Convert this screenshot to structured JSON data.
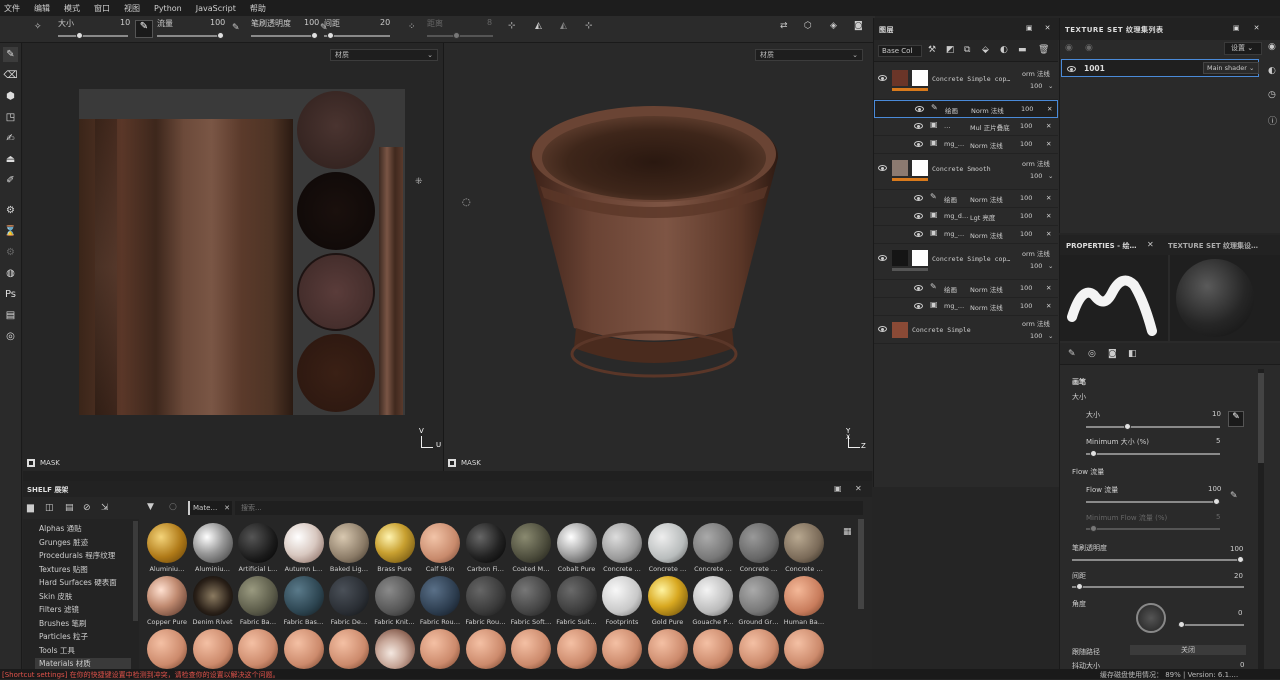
{
  "menu": [
    "文件",
    "编辑",
    "模式",
    "窗口",
    "视图",
    "Python",
    "JavaScript",
    "帮助"
  ],
  "toolbar": {
    "size_label": "大小",
    "size_value": "10",
    "flow_label": "流量",
    "flow_value": "100",
    "opacity_label": "笔刷透明度",
    "opacity_value": "100",
    "spacing_label": "间距",
    "spacing_value": "20",
    "distance_label": "距离",
    "distance_value": "8"
  },
  "viewport2d": {
    "channel": "材质",
    "mask": "MASK",
    "axis_v": "V",
    "axis_u": "U"
  },
  "viewport3d": {
    "channel": "材质",
    "mask": "MASK",
    "axis_y": "Y",
    "axis_z": "Z",
    "axis_x": "X"
  },
  "layers": {
    "title": "图层",
    "blend_select": "Base Col",
    "rows": [
      {
        "name": "Concrete Simple cop…",
        "ch": "orm 法线",
        "opacity": "100"
      },
      {
        "name": "绘画",
        "mode": "Norm 法线",
        "opacity": "100"
      },
      {
        "name": "…",
        "mode": "Mul 正片叠底",
        "opacity": "100"
      },
      {
        "name": "mg_…",
        "mode": "Norm 法线",
        "opacity": "100"
      },
      {
        "name": "Concrete Smooth",
        "ch": "orm 法线",
        "opacity": "100"
      },
      {
        "name": "绘画",
        "mode": "Norm 法线",
        "opacity": "100"
      },
      {
        "name": "mg_d…",
        "mode": "Lgt 亮度",
        "opacity": "100"
      },
      {
        "name": "mg_…",
        "mode": "Norm 法线",
        "opacity": "100"
      },
      {
        "name": "Concrete Simple cop…",
        "ch": "orm 法线",
        "opacity": "100"
      },
      {
        "name": "绘画",
        "mode": "Norm 法线",
        "opacity": "100"
      },
      {
        "name": "mg_…",
        "mode": "Norm 法线",
        "opacity": "100"
      },
      {
        "name": "Concrete Simple",
        "ch": "orm 法线",
        "opacity": "100"
      }
    ]
  },
  "texture_sets": {
    "title": "TEXTURE SET 纹理集列表",
    "settings": "设置",
    "item": "1001",
    "shader": "Main shader"
  },
  "properties": {
    "tab1": "PROPERTIES - 绘…",
    "tab2": "TEXTURE SET 纹理集设…",
    "section": "画笔",
    "size_header": "大小",
    "size_label": "大小",
    "size_value": "10",
    "min_size_label": "Minimum 大小 (%)",
    "min_size_value": "5",
    "flow_header": "Flow 流量",
    "flow_label": "Flow 流量",
    "flow_value": "100",
    "min_flow_label": "Minimum Flow 流量 (%)",
    "min_flow_value": "5",
    "opacity_label": "笔刷透明度",
    "opacity_value": "100",
    "spacing_label": "间距",
    "spacing_value": "20",
    "angle_label": "角度",
    "angle_value": "0",
    "follow_label": "跟随路径",
    "follow_value": "关闭",
    "jitter_label": "抖动大小",
    "jitter_value": "0"
  },
  "shelf": {
    "title": "SHELF 展架",
    "filter_tag": "Mate…",
    "search_placeholder": "搜索...",
    "categories": [
      "Alphas 通贴",
      "Grunges 脏迹",
      "Procedurals 程序纹理",
      "Textures 贴图",
      "Hard Surfaces 硬表面",
      "Skin 皮肤",
      "Filters 滤镜",
      "Brushes 笔刷",
      "Particles 粒子",
      "Tools 工具",
      "Materials 材质"
    ],
    "row1": [
      "Aluminiu…",
      "Aluminiu…",
      "Artificial L…",
      "Autumn L…",
      "Baked Lig…",
      "Brass Pure",
      "Calf Skin",
      "Carbon Fi…",
      "Coated M…",
      "Cobalt Pure",
      "Concrete …",
      "Concrete …",
      "Concrete …",
      "Concrete …",
      "Concrete …"
    ],
    "row2": [
      "Copper Pure",
      "Denim Rivet",
      "Fabric Ba…",
      "Fabric Bas…",
      "Fabric De…",
      "Fabric Knit…",
      "Fabric Rou…",
      "Fabric Rou…",
      "Fabric Soft…",
      "Fabric Suit…",
      "Footprints",
      "Gold Pure",
      "Gouache P…",
      "Ground Gr…",
      "Human Ba…"
    ]
  },
  "status": {
    "left": "[Shortcut settings] 在你的快捷键设置中检测到冲突，请检查你的设置以解决这个问题。",
    "right": "缓存磁盘使用情况：  89%  |  Version: 6.1.…"
  }
}
